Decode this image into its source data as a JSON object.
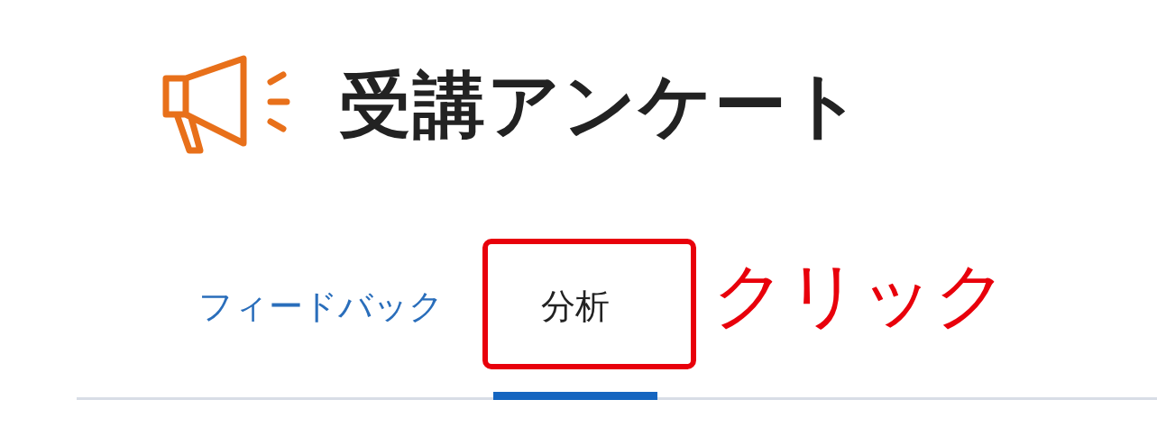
{
  "title": "受講アンケート",
  "tabs": [
    {
      "label": "フィードバック",
      "selected": false
    },
    {
      "label": "分析",
      "selected": true
    }
  ],
  "annotation": {
    "label": "クリック"
  }
}
